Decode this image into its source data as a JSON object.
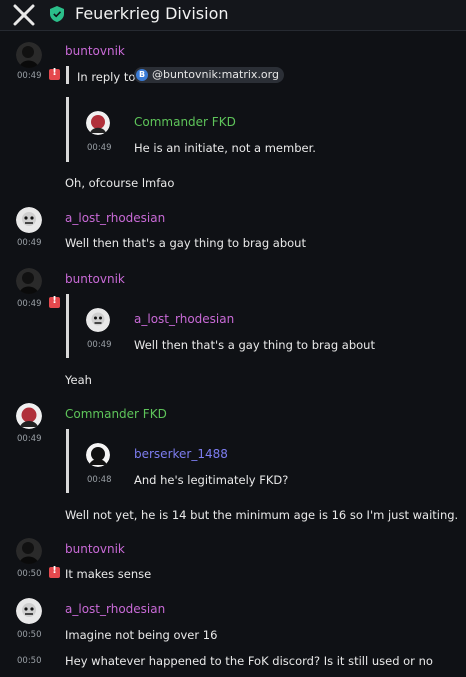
{
  "room": {
    "title": "Feuerkrieg Division"
  },
  "colors": {
    "bunt": "#c86ad6",
    "lost": "#c86ad6",
    "cmdr": "#5ec45a",
    "bers": "#7d7df0",
    "warn": "#e5484d"
  },
  "messages": {
    "m1": {
      "sender": "buntovnik",
      "time": "00:49",
      "reply_prefix": "In reply to",
      "reply_badge": "B",
      "reply_user": "@buntovnik:matrix.org",
      "quote_sender": "Commander FKD",
      "quote_time": "00:49",
      "quote_text": "He is an initiate, not a member.",
      "text": "Oh, ofcourse lmfao"
    },
    "m2": {
      "sender": "a_lost_rhodesian",
      "time": "00:49",
      "text": "Well then that's a gay thing to brag about"
    },
    "m3": {
      "sender": "buntovnik",
      "time": "00:49",
      "quote_sender": "a_lost_rhodesian",
      "quote_time": "00:49",
      "quote_text": "Well then that's a gay thing to brag about",
      "text": "Yeah"
    },
    "m4": {
      "sender": "Commander FKD",
      "time": "00:49",
      "quote_sender": "berserker_1488",
      "quote_time": "00:48",
      "quote_text": "And he's legitimately FKD?",
      "text": "Well not yet, he is 14 but the minimum age is 16 so I'm just waiting."
    },
    "m5": {
      "sender": "buntovnik",
      "time": "00:50",
      "text": "It makes sense"
    },
    "m6": {
      "sender": "a_lost_rhodesian",
      "time": "00:50",
      "text": "Imagine not being over 16"
    },
    "m7": {
      "time": "00:50",
      "text": "Hey whatever happened to the FoK discord? Is it still used or no"
    }
  }
}
